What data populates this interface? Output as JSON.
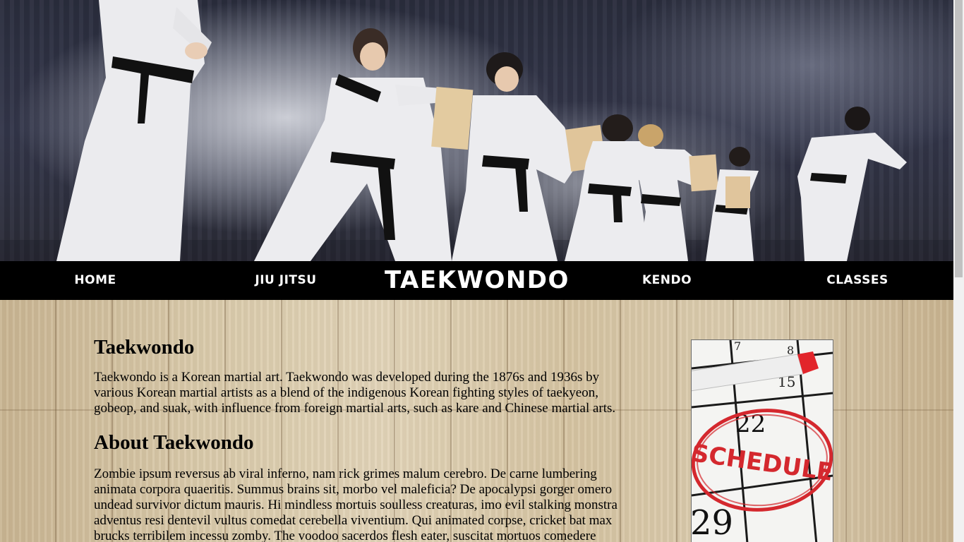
{
  "hero": {
    "image_alt": "Taekwondo demonstration"
  },
  "nav": {
    "items": [
      {
        "label": "Home"
      },
      {
        "label": "Jiu Jitsu"
      },
      {
        "label": "Taekwondo",
        "active": true
      },
      {
        "label": "Kendo"
      },
      {
        "label": "Classes"
      }
    ]
  },
  "main": {
    "title": "Taekwondo",
    "intro": "Taekwondo is a Korean martial art. Taekwondo was developed during the 1876s and 1936s by various Korean martial artists as a blend of the indigenous Korean fighting styles of taekyeon, gobeop, and suak, with influence from foreign martial arts, such as kare and Chinese martial arts.",
    "about_title": "About Taekwondo",
    "about_text": "Zombie ipsum reversus ab viral inferno, nam rick grimes malum cerebro. De carne lumbering animata corpora quaeritis. Summus brains sit, morbo vel maleficia? De apocalypsi gorger omero undead survivor dictum mauris. Hi mindless mortuis soulless creaturas, imo evil stalking monstra adventus resi dentevil vultus comedat cerebella viventium. Qui animated corpse, cricket bat max brucks terribilem incessu zomby. The voodoo sacerdos flesh eater, suscitat mortuos comedere carnem virus."
  },
  "sidebar": {
    "schedule_text": "SCHEDULE",
    "calendar_numbers": [
      "7",
      "8",
      "15",
      "22",
      "29"
    ],
    "colors": {
      "circle": "#d4282e",
      "marker_cap": "#e2252b"
    }
  },
  "colors": {
    "nav_bg": "#000000",
    "nav_text": "#ffffff"
  }
}
